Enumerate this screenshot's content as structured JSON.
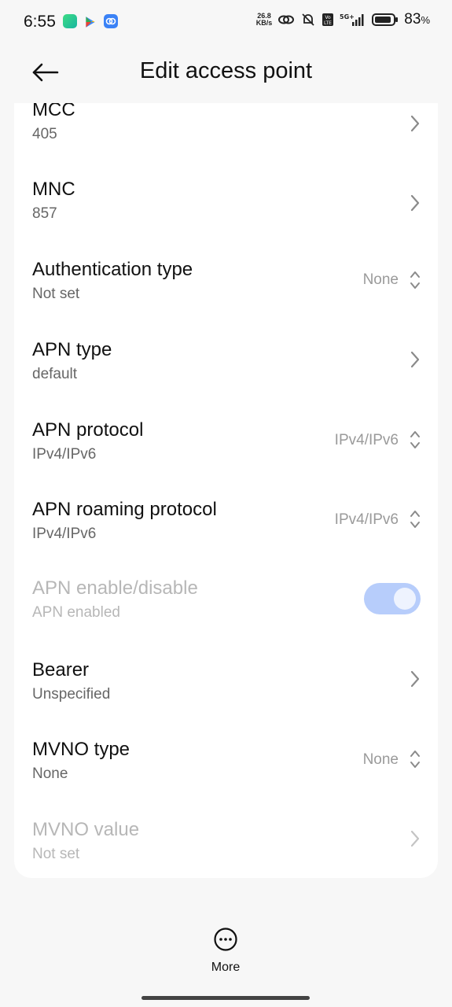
{
  "status_bar": {
    "time": "6:55",
    "net_speed_value": "26.8",
    "net_speed_unit": "KB/s",
    "battery": "83",
    "battery_unit": "%"
  },
  "header": {
    "title": "Edit access point",
    "back_icon": "back-arrow-icon"
  },
  "settings": [
    {
      "title": "MCC",
      "subtitle": "405",
      "value": "",
      "control": "chevron",
      "enabled": true
    },
    {
      "title": "MNC",
      "subtitle": "857",
      "value": "",
      "control": "chevron",
      "enabled": true
    },
    {
      "title": "Authentication type",
      "subtitle": "Not set",
      "value": "None",
      "control": "updown",
      "enabled": true
    },
    {
      "title": "APN type",
      "subtitle": "default",
      "value": "",
      "control": "chevron",
      "enabled": true
    },
    {
      "title": "APN protocol",
      "subtitle": "IPv4/IPv6",
      "value": "IPv4/IPv6",
      "control": "updown",
      "enabled": true
    },
    {
      "title": "APN roaming protocol",
      "subtitle": "IPv4/IPv6",
      "value": "IPv4/IPv6",
      "control": "updown",
      "enabled": true
    },
    {
      "title": "APN enable/disable",
      "subtitle": "APN enabled",
      "value": "",
      "control": "toggle",
      "enabled": false,
      "toggle_on": true
    },
    {
      "title": "Bearer",
      "subtitle": "Unspecified",
      "value": "",
      "control": "chevron",
      "enabled": true
    },
    {
      "title": "MVNO type",
      "subtitle": "None",
      "value": "None",
      "control": "updown",
      "enabled": true
    },
    {
      "title": "MVNO value",
      "subtitle": "Not set",
      "value": "",
      "control": "chevron",
      "enabled": false
    }
  ],
  "bottom": {
    "more_label": "More",
    "more_icon": "more-horizontal-icon"
  },
  "colors": {
    "toggle_track": "#b7cdfb",
    "disabled_text": "#b7b7b7"
  }
}
